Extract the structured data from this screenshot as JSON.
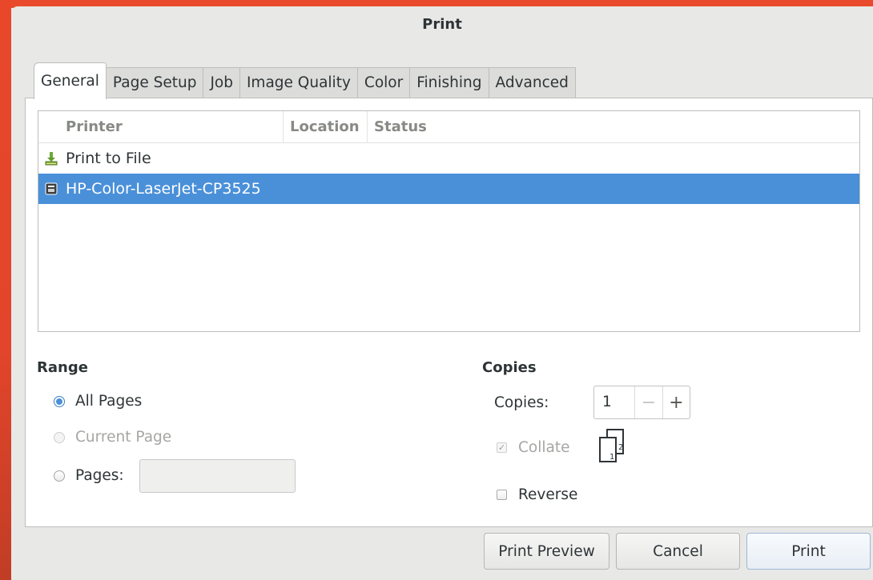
{
  "dialog": {
    "title": "Print"
  },
  "tabs": [
    {
      "label": "General",
      "active": true
    },
    {
      "label": "Page Setup"
    },
    {
      "label": "Job"
    },
    {
      "label": "Image Quality"
    },
    {
      "label": "Color"
    },
    {
      "label": "Finishing"
    },
    {
      "label": "Advanced"
    }
  ],
  "printer_list": {
    "columns": [
      "Printer",
      "Location",
      "Status"
    ],
    "rows": [
      {
        "name": "Print to File",
        "icon": "print-to-file-icon",
        "selected": false
      },
      {
        "name": "HP-Color-LaserJet-CP3525",
        "icon": "printer-icon",
        "selected": true
      }
    ]
  },
  "range": {
    "title": "Range",
    "options": [
      {
        "label": "All Pages",
        "checked": true,
        "enabled": true
      },
      {
        "label": "Current Page",
        "checked": false,
        "enabled": false
      },
      {
        "label": "Pages:",
        "checked": false,
        "enabled": true
      }
    ],
    "pages_value": ""
  },
  "copies": {
    "title": "Copies",
    "copies_label": "Copies:",
    "copies_value": "1",
    "minus": "−",
    "plus": "+",
    "collate_label": "Collate",
    "collate_checked": true,
    "collate_enabled": false,
    "collate_icon_pages": [
      "1",
      "2"
    ],
    "reverse_label": "Reverse",
    "reverse_checked": false
  },
  "buttons": {
    "preview": "Print Preview",
    "cancel": "Cancel",
    "print": "Print"
  },
  "colors": {
    "accent": "#4a90d9",
    "desktop": "#e8472a",
    "dialog_bg": "#e8e8e7"
  }
}
